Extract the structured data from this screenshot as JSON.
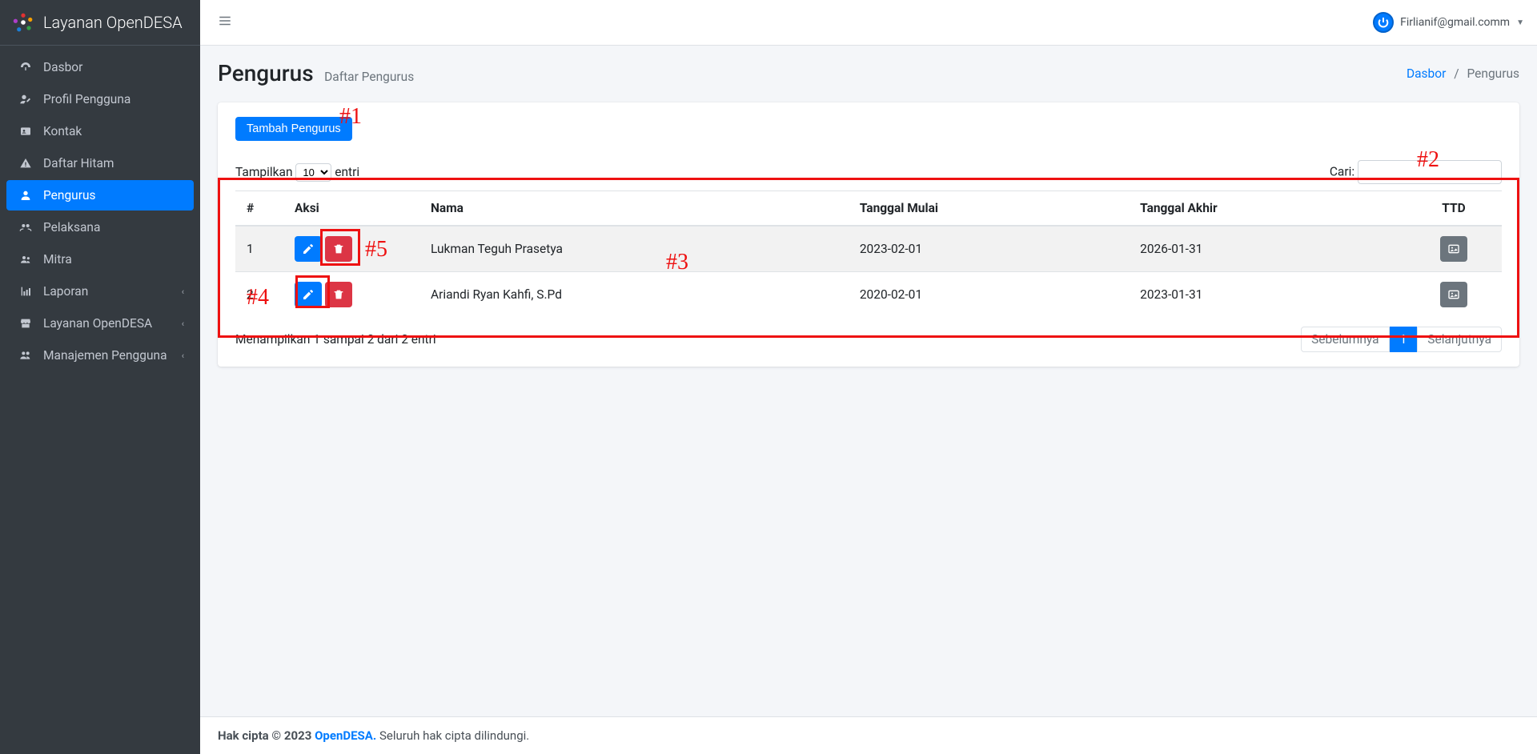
{
  "brand": {
    "name": "Layanan OpenDESA"
  },
  "user": {
    "email": "Firlianif@gmail.comm"
  },
  "sidebar": {
    "items": [
      {
        "label": "Dasbor",
        "icon": "dashboard-icon",
        "active": false,
        "expandable": false
      },
      {
        "label": "Profil Pengguna",
        "icon": "user-edit-icon",
        "active": false,
        "expandable": false
      },
      {
        "label": "Kontak",
        "icon": "contact-icon",
        "active": false,
        "expandable": false
      },
      {
        "label": "Daftar Hitam",
        "icon": "warning-icon",
        "active": false,
        "expandable": false
      },
      {
        "label": "Pengurus",
        "icon": "user-icon",
        "active": true,
        "expandable": false
      },
      {
        "label": "Pelaksana",
        "icon": "group-icon",
        "active": false,
        "expandable": false
      },
      {
        "label": "Mitra",
        "icon": "users-icon",
        "active": false,
        "expandable": false
      },
      {
        "label": "Laporan",
        "icon": "chart-icon",
        "active": false,
        "expandable": true
      },
      {
        "label": "Layanan OpenDESA",
        "icon": "store-icon",
        "active": false,
        "expandable": true
      },
      {
        "label": "Manajemen Pengguna",
        "icon": "people-icon",
        "active": false,
        "expandable": true
      }
    ]
  },
  "page": {
    "title": "Pengurus",
    "subtitle": "Daftar Pengurus",
    "breadcrumbs": {
      "root": "Dasbor",
      "current": "Pengurus"
    }
  },
  "toolbar": {
    "add_label": "Tambah Pengurus"
  },
  "datatable": {
    "length_prefix": "Tampilkan",
    "length_suffix": "entri",
    "length_value": "10",
    "search_label": "Cari:",
    "columns": [
      "#",
      "Aksi",
      "Nama",
      "Tanggal Mulai",
      "Tanggal Akhir",
      "TTD"
    ],
    "rows": [
      {
        "no": "1",
        "nama": "Lukman Teguh Prasetya",
        "mulai": "2023-02-01",
        "akhir": "2026-01-31"
      },
      {
        "no": "2",
        "nama": "Ariandi Ryan Kahfi, S.Pd",
        "mulai": "2020-02-01",
        "akhir": "2023-01-31"
      }
    ],
    "info": "Menampilkan 1 sampai 2 dari 2 entri",
    "pager": {
      "prev": "Sebelumnya",
      "next": "Selanjutnya",
      "pages": [
        "1"
      ],
      "active": "1"
    }
  },
  "footer": {
    "copyright_prefix": "Hak cipta © 2023 ",
    "brand": "OpenDESA.",
    "suffix": " Seluruh hak cipta dilindungi."
  },
  "annotations": {
    "1": "#1",
    "2": "#2",
    "3": "#3",
    "4": "#4",
    "5": "#5"
  }
}
